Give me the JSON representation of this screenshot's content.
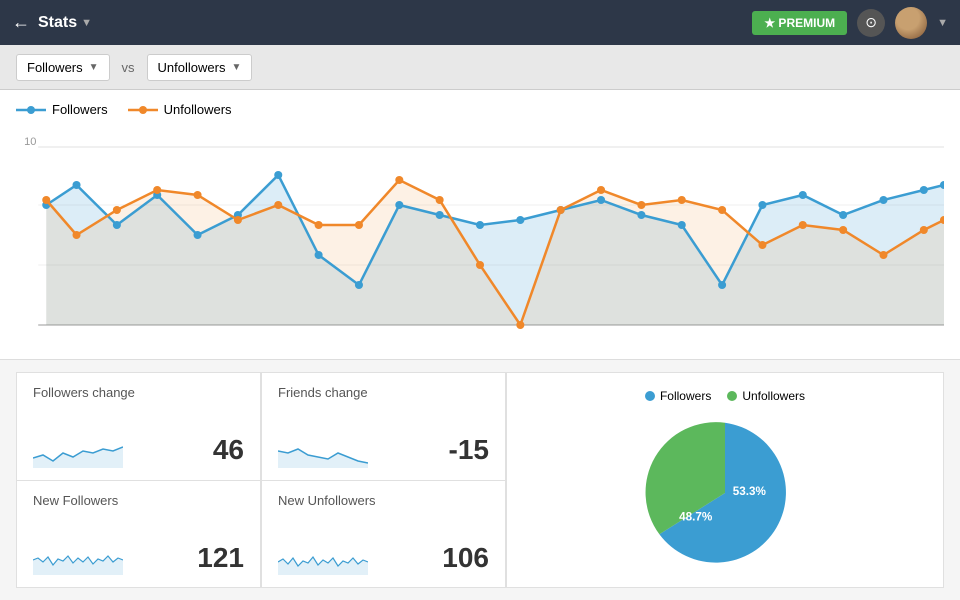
{
  "header": {
    "back_icon": "←",
    "title": "Stats",
    "title_arrow": "▼",
    "premium_label": "★ PREMIUM",
    "refresh_icon": "↻",
    "dropdown_arrow": "▼"
  },
  "controls": {
    "metric1": "Followers",
    "metric1_arrow": "▼",
    "vs_label": "vs",
    "metric2": "Unfollowers",
    "metric2_arrow": "▼"
  },
  "chart": {
    "y_label": "10",
    "legend": {
      "followers_label": "Followers",
      "unfollowers_label": "Unfollowers"
    }
  },
  "stats": {
    "followers_change_label": "Followers change",
    "followers_change_value": "46",
    "friends_change_label": "Friends change",
    "friends_change_value": "-15",
    "new_followers_label": "New Followers",
    "new_followers_value": "121",
    "new_unfollowers_label": "New Unfollowers",
    "new_unfollowers_value": "106"
  },
  "pie": {
    "followers_label": "Followers",
    "unfollowers_label": "Unfollowers",
    "followers_pct": "53.3%",
    "unfollowers_pct": "48.7%",
    "followers_color": "#3b9dd2",
    "unfollowers_color": "#5cb85c"
  },
  "colors": {
    "followers_line": "#3b9dd2",
    "unfollowers_line": "#f0882a",
    "header_bg": "#2d3748",
    "premium_green": "#4caf50"
  }
}
